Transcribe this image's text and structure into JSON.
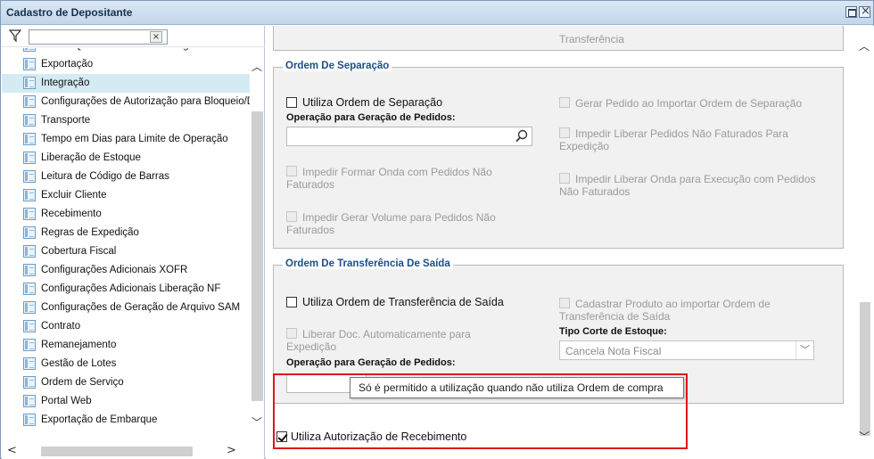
{
  "window": {
    "title": "Cadastro de Depositante"
  },
  "filter": {
    "placeholder": "",
    "value": "",
    "clear_label": "×"
  },
  "tree": {
    "items": [
      {
        "label": "Alterar Qtde. Pedido Armazenagem",
        "selected": false
      },
      {
        "label": "Exportação",
        "selected": false
      },
      {
        "label": "Integração",
        "selected": true
      },
      {
        "label": "Configurações de Autorização para Bloqueio/D",
        "selected": false
      },
      {
        "label": "Transporte",
        "selected": false
      },
      {
        "label": "Tempo em Dias para Limite de Operação",
        "selected": false
      },
      {
        "label": "Liberação de Estoque",
        "selected": false
      },
      {
        "label": "Leitura de Código de Barras",
        "selected": false
      },
      {
        "label": "Excluir Cliente",
        "selected": false
      },
      {
        "label": "Recebimento",
        "selected": false
      },
      {
        "label": "Regras de Expedição",
        "selected": false
      },
      {
        "label": "Cobertura Fiscal",
        "selected": false
      },
      {
        "label": "Configurações Adicionais XOFR",
        "selected": false
      },
      {
        "label": "Configurações Adicionais Liberação NF",
        "selected": false
      },
      {
        "label": "Configurações de Geração de Arquivo SAM",
        "selected": false
      },
      {
        "label": "Contrato",
        "selected": false
      },
      {
        "label": "Remanejamento",
        "selected": false
      },
      {
        "label": "Gestão de Lotes",
        "selected": false
      },
      {
        "label": "Ordem de Serviço",
        "selected": false
      },
      {
        "label": "Portal Web",
        "selected": false
      },
      {
        "label": "Exportação de Embarque",
        "selected": false
      }
    ]
  },
  "top_section": {
    "partial_label": "Transferência"
  },
  "ordem_separacao": {
    "title": "Ordem De Separação",
    "utiliza": {
      "label": "Utiliza Ordem de Separação",
      "checked": false
    },
    "operacao_label": "Operação para Geração de Pedidos:",
    "operacao_value": "",
    "impedir_formar_onda": "Impedir Formar Onda com Pedidos Não Faturados",
    "impedir_gerar_volume": "Impedir Gerar Volume para Pedidos Não Faturados",
    "gerar_pedido": "Gerar Pedido ao Importar Ordem de Separação",
    "impedir_liberar_pedidos": "Impedir Liberar Pedidos Não Faturados Para Expedição",
    "impedir_liberar_onda": "Impedir Liberar Onda para Execução com Pedidos Não Faturados"
  },
  "ordem_transferencia": {
    "title": "Ordem De Transferência De Saída",
    "utiliza": {
      "label": "Utiliza Ordem de Transferência de Saída",
      "checked": false
    },
    "liberar_doc": "Liberar Doc. Automaticamente para Expedição",
    "operacao_label": "Operação para Geração de Pedidos:",
    "operacao_value": "",
    "cadastrar_produto": "Cadastrar Produto ao importar Ordem de Transferência de Saída",
    "tipo_corte_label": "Tipo Corte de Estoque:",
    "tipo_corte_value": "Cancela Nota Fiscal"
  },
  "tooltip": {
    "text": "Só é permitido a utilização quando não utiliza Ordem de compra"
  },
  "autorizacao": {
    "label": "Utiliza Autorização de Recebimento",
    "checked": true
  },
  "colors": {
    "highlight": "#e2141c",
    "group_title": "#1c4f86",
    "selected_row": "#d4ebf3"
  }
}
